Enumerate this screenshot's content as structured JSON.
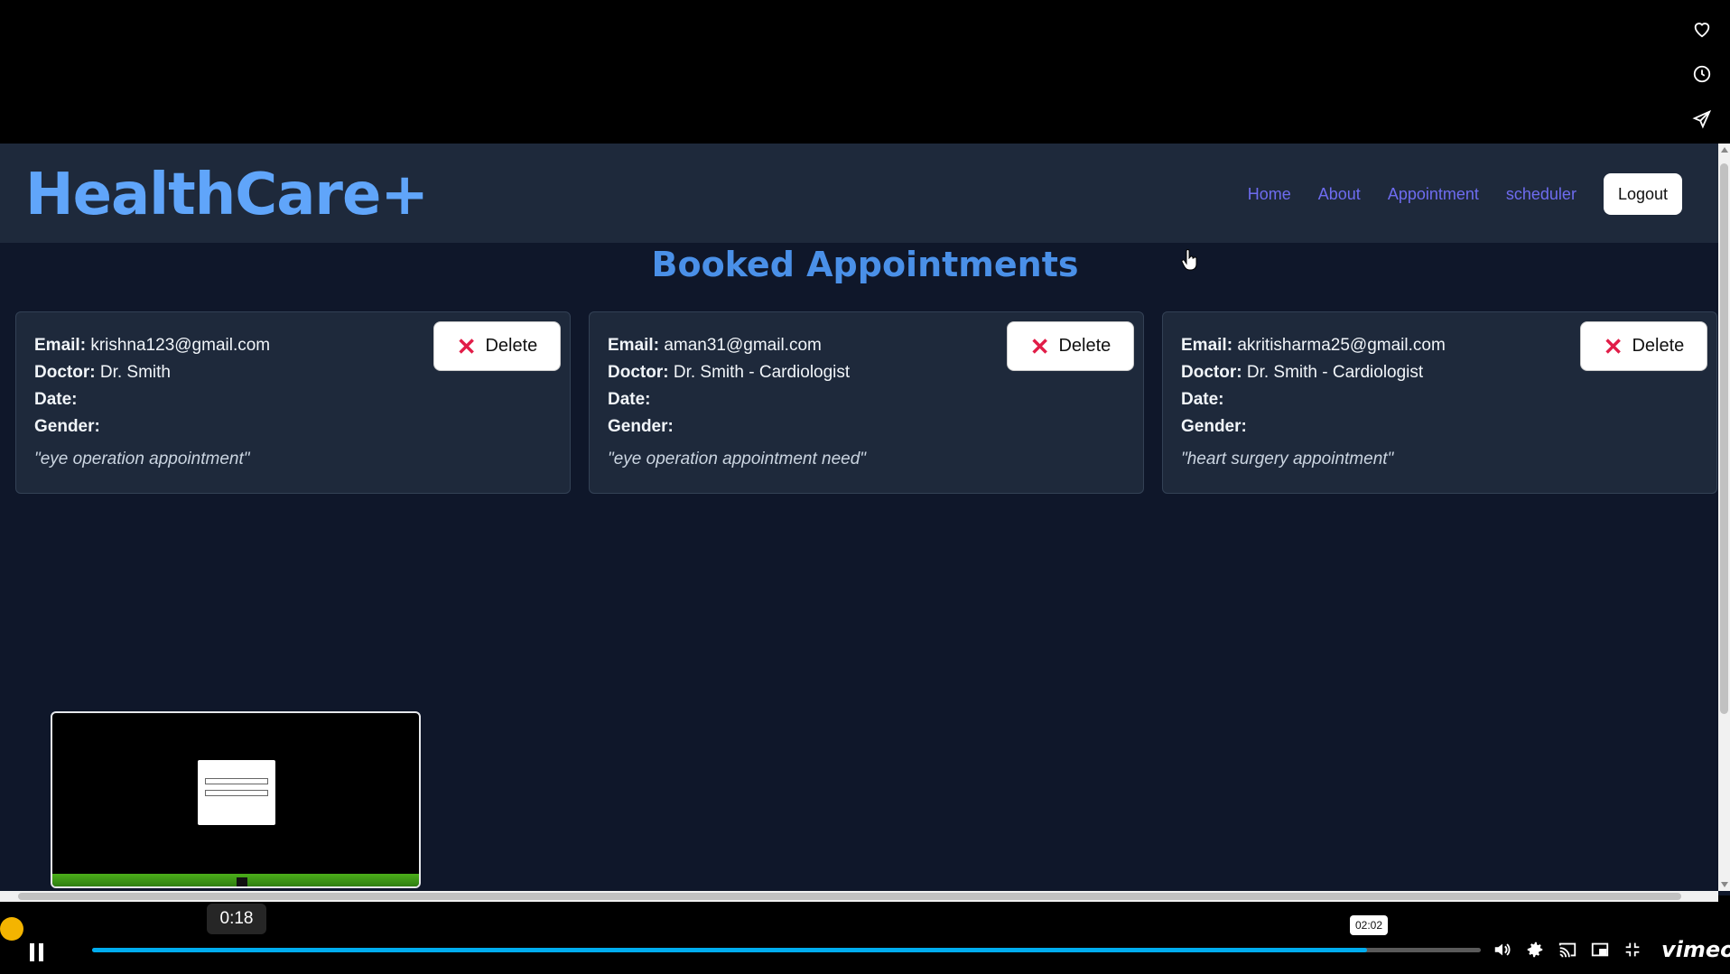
{
  "app": {
    "brand": "HealthCare+",
    "nav": [
      "Home",
      "About",
      "Appointment",
      "scheduler"
    ],
    "logout_label": "Logout",
    "page_title": "Booked Appointments"
  },
  "labels": {
    "email": "Email:",
    "doctor": "Doctor:",
    "date": "Date:",
    "gender": "Gender:",
    "delete": "Delete"
  },
  "appointments": [
    {
      "email": "krishna123@gmail.com",
      "doctor": "Dr. Smith",
      "date": "",
      "gender": "",
      "note": "\"eye operation appointment\""
    },
    {
      "email": "aman31@gmail.com",
      "doctor": "Dr. Smith - Cardiologist",
      "date": "",
      "gender": "",
      "note": "\"eye operation appointment need\""
    },
    {
      "email": "akritisharma25@gmail.com",
      "doctor": "Dr. Smith - Cardiologist",
      "date": "",
      "gender": "",
      "note": "\"heart surgery appointment\""
    }
  ],
  "player": {
    "current_time": "0:18",
    "hover_time": "02:02",
    "progress_fraction": 0.918,
    "brand": "vimeo",
    "accent": "#00adef"
  },
  "icons": [
    "heart-icon",
    "clock-icon",
    "send-icon",
    "volume-icon",
    "settings-icon",
    "cast-icon",
    "pip-icon",
    "fullscreen-exit-icon"
  ]
}
